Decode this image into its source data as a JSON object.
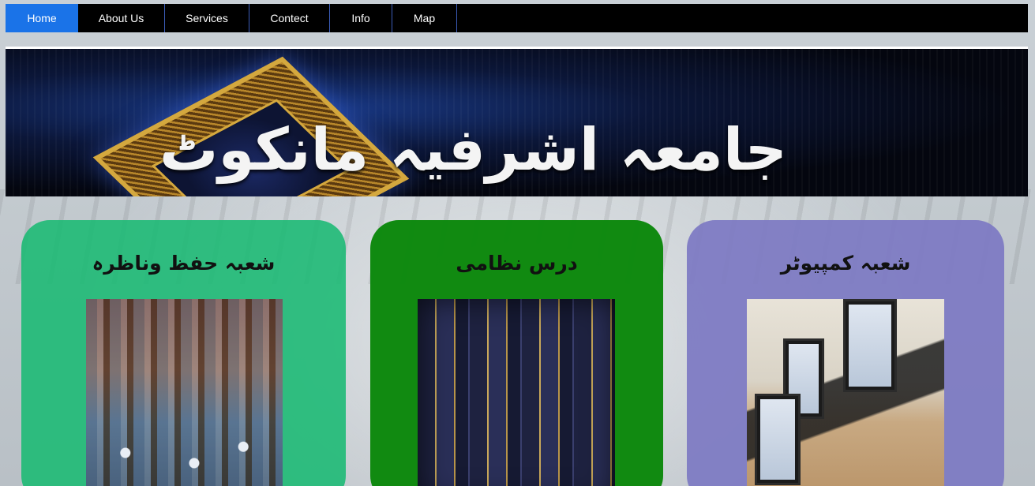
{
  "nav": {
    "items": [
      {
        "label": "Home",
        "active": true
      },
      {
        "label": "About Us",
        "active": false
      },
      {
        "label": "Services",
        "active": false
      },
      {
        "label": "Contect",
        "active": false
      },
      {
        "label": "Info",
        "active": false
      },
      {
        "label": "Map",
        "active": false
      }
    ]
  },
  "header": {
    "title": "جامعہ اشرفیہ مانکوٹ"
  },
  "cards": [
    {
      "title": "شعبہ حفظ وناظرہ",
      "color": "#19b973"
    },
    {
      "title": "درس نظامی",
      "color": "#0a870a"
    },
    {
      "title": "شعبہ کمپیوٹر",
      "color": "#7d7ac3"
    }
  ],
  "colors": {
    "nav_background": "#000000",
    "nav_active": "#1a73e8"
  }
}
